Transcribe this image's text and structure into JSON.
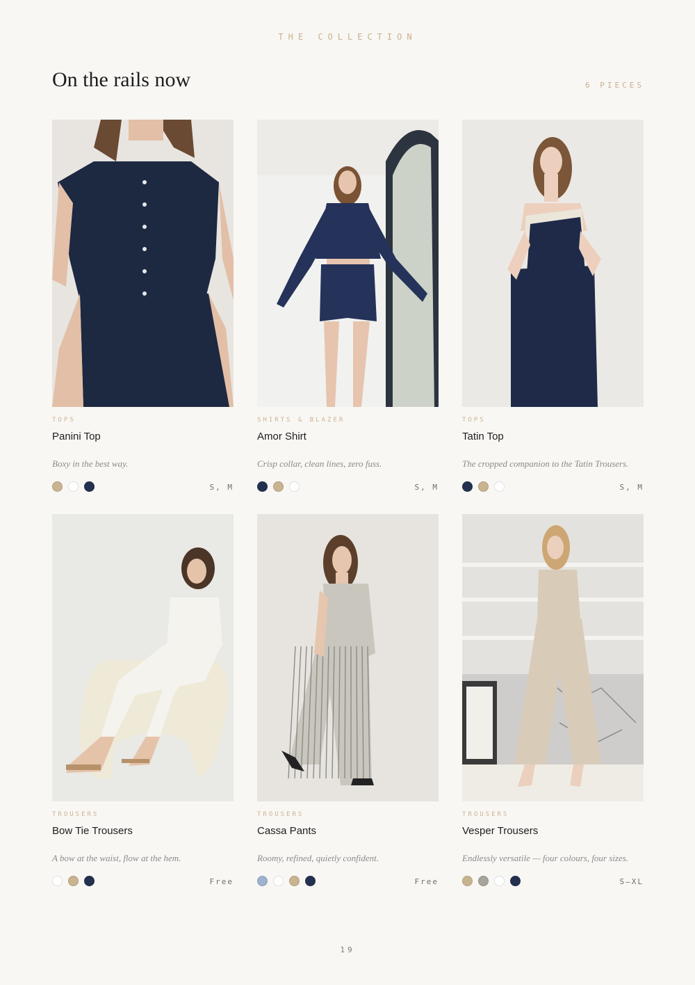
{
  "eyebrow": "THE COLLECTION",
  "title": "On the rails now",
  "count": "6 PIECES",
  "page_number": "19",
  "products": [
    {
      "category": "TOPS",
      "name": "Panini Top",
      "description": "Boxy in the best way.",
      "sizes": "S, M",
      "swatches": [
        "#c9b48f",
        "#ffffff",
        "#24304f"
      ],
      "image": {
        "bg": "#e8e5e0",
        "garment": "#1d2841",
        "skin": "#e2bfa6",
        "hair": "#6a4a32"
      }
    },
    {
      "category": "SHIRTS & BLAZER",
      "name": "Amor Shirt",
      "description": "Crisp collar, clean lines, zero fuss.",
      "sizes": "S, M",
      "swatches": [
        "#24304f",
        "#c9b48f",
        "#ffffff"
      ],
      "image": {
        "bg": "#ecebe8",
        "garment": "#25325a",
        "skin": "#e6c4ad",
        "hair": "#7a5234"
      }
    },
    {
      "category": "TOPS",
      "name": "Tatin Top",
      "description": "The cropped companion to the Tatin Trousers.",
      "sizes": "S, M",
      "swatches": [
        "#24304f",
        "#c9b48f",
        "#ffffff"
      ],
      "image": {
        "bg": "#ebe9e6",
        "garment": "#1e2a47",
        "skin": "#ecd0bd",
        "hair": "#7b5638"
      }
    },
    {
      "category": "TROUSERS",
      "name": "Bow Tie Trousers",
      "description": "A bow at the waist, flow at the hem.",
      "sizes": "Free",
      "swatches": [
        "#ffffff",
        "#c9b48f",
        "#24304f"
      ],
      "image": {
        "bg": "#e9e9e6",
        "garment": "#f5f3ee",
        "skin": "#e5c3a9",
        "hair": "#4a3526"
      }
    },
    {
      "category": "TROUSERS",
      "name": "Cassa Pants",
      "description": "Roomy, refined, quietly confident.",
      "sizes": "Free",
      "swatches": [
        "#9db3d0",
        "#ffffff",
        "#c9b48f",
        "#24304f"
      ],
      "image": {
        "bg": "#e7e4df",
        "garment": "#c9c6bd",
        "skin": "#e6c6ae",
        "hair": "#5b3f2b"
      }
    },
    {
      "category": "TROUSERS",
      "name": "Vesper Trousers",
      "description": "Endlessly versatile — four colours, four sizes.",
      "sizes": "S–XL",
      "swatches": [
        "#c9b48f",
        "#a8a39b",
        "#ffffff",
        "#24304f"
      ],
      "image": {
        "bg": "#e4e2de",
        "garment": "#d8ccb9",
        "skin": "#ead0bd",
        "hair": "#cda674"
      }
    }
  ]
}
